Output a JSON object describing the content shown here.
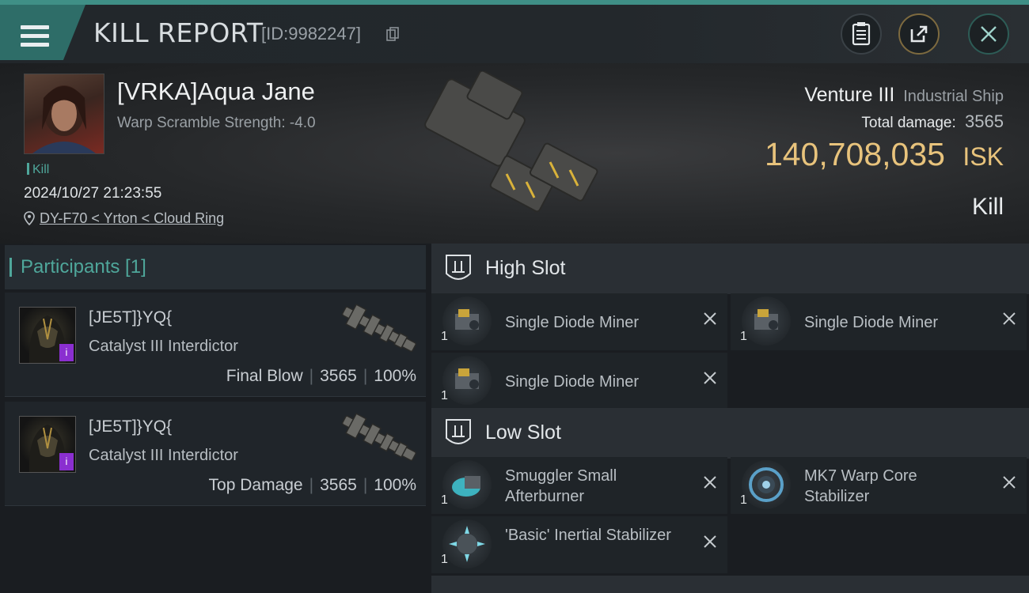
{
  "header": {
    "title": "KILL REPORT",
    "report_id": "[ID:9982247]",
    "icons": [
      "menu-icon",
      "copy-icon",
      "clipboard-icon",
      "share-icon",
      "close-icon"
    ]
  },
  "victim": {
    "name": "[VRKA]Aqua Jane",
    "scramble": "Warp Scramble Strength: -4.0",
    "tag": "Kill",
    "timestamp": "2024/10/27 21:23:55",
    "location": "DY-F70 < Yrton < Cloud Ring"
  },
  "ship": {
    "name": "Venture III",
    "class": "Industrial Ship",
    "total_damage_label": "Total damage:",
    "total_damage": "3565",
    "isk_value": "140,708,035",
    "isk_unit": "ISK",
    "result": "Kill"
  },
  "participants": {
    "title": "Participants [1]",
    "items": [
      {
        "name": "[JE5T]}YQ{",
        "ship": "Catalyst III Interdictor",
        "role": "Final Blow",
        "damage": "3565",
        "percent": "100%",
        "badge": "i"
      },
      {
        "name": "[JE5T]}YQ{",
        "ship": "Catalyst III Interdictor",
        "role": "Top Damage",
        "damage": "3565",
        "percent": "100%",
        "badge": "i"
      }
    ]
  },
  "high_slot": {
    "label": "High Slot",
    "modules": [
      {
        "name": "Single Diode Miner",
        "qty": "1"
      },
      {
        "name": "Single Diode Miner",
        "qty": "1"
      },
      {
        "name": "Single Diode Miner",
        "qty": "1"
      }
    ]
  },
  "low_slot": {
    "label": "Low Slot",
    "modules": [
      {
        "name": "Smuggler Small Afterburner",
        "qty": "1"
      },
      {
        "name": "MK7 Warp Core Stabilizer",
        "qty": "1"
      },
      {
        "name": "'Basic' Inertial Stabilizer",
        "qty": "1"
      }
    ]
  },
  "colors": {
    "accent": "#4fa79b",
    "isk": "#e8c37c",
    "badge": "#8a2fd0"
  }
}
